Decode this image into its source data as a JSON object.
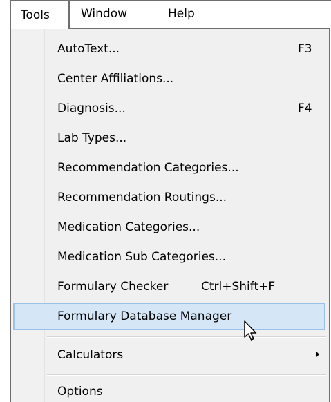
{
  "menubar": {
    "tools": "Tools",
    "window": "Window",
    "help": "Help"
  },
  "tools_menu": {
    "items": [
      {
        "label": "AutoText...",
        "shortcut": "F3"
      },
      {
        "label": "Center Affiliations...",
        "shortcut": ""
      },
      {
        "label": "Diagnosis...",
        "shortcut": "F4"
      },
      {
        "label": "Lab Types...",
        "shortcut": ""
      },
      {
        "label": "Recommendation Categories...",
        "shortcut": ""
      },
      {
        "label": "Recommendation Routings...",
        "shortcut": ""
      },
      {
        "label": "Medication Categories...",
        "shortcut": ""
      },
      {
        "label": "Medication Sub Categories...",
        "shortcut": ""
      },
      {
        "label": "Formulary Checker",
        "shortcut": "Ctrl+Shift+F"
      },
      {
        "label": "Formulary Database Manager",
        "shortcut": "",
        "highlighted": true
      },
      {
        "label": "Calculators",
        "shortcut": "",
        "submenu": true
      },
      {
        "label": "Options",
        "shortcut": ""
      }
    ]
  },
  "colors": {
    "highlight_fill": "#d5e6f7",
    "highlight_border": "#9bc1e9",
    "menu_background": "#f0f0f0",
    "border": "#6f6f6f"
  },
  "icons": {
    "submenu_arrow": "chevron-right-icon",
    "cursor": "mouse-pointer-icon"
  }
}
